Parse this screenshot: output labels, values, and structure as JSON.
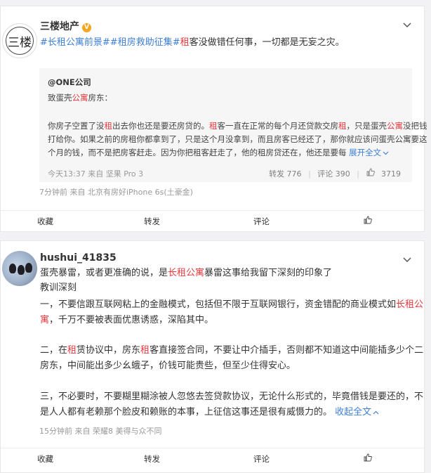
{
  "post1": {
    "author": "三楼地产",
    "verified_badge": "V",
    "avatar_glyph": "三楼",
    "body": {
      "tag1": "#长租公寓前景#",
      "tag2": "#租房救助征集#",
      "k1": "租",
      "rest": "客没做错任何事，一切都是无妄之灾。"
    },
    "quote": {
      "author": "@ONE公司",
      "greeting": {
        "a": "致蛋壳",
        "k": "公寓",
        "b": "房东："
      },
      "p1": {
        "a": "你房子空置了没",
        "k1": "租",
        "b": "出去你也还是要还房贷的。",
        "k2": "租",
        "c": "客一直在正常的每个月还贷款交房",
        "k3": "租",
        "d": "，只是蛋壳",
        "k4": "公寓",
        "e": "没把钱"
      },
      "p2": "打给你。如果之前的房租你都拿到了，只是这个月没拿到，而且房客已经还了，那你就应该问蛋壳公寓要这",
      "p3": "个月的钱，而不是把房客赶走。因为你把租客赶走了，他的租房贷还在，他还是要每",
      "expand": "展开全文",
      "time": "今天13:37",
      "source": "来自 坚果 Pro 3",
      "reposts": "转发 776",
      "comments": "评论 390",
      "likes": "3719"
    },
    "footer_meta": "7分钟前  来自 北京有房好iPhone 6s(土豪金)",
    "actions": {
      "fav": "收藏",
      "repost": "转发",
      "comment": "评论"
    }
  },
  "post2": {
    "author": "hushui_41835",
    "lines": {
      "l1": {
        "a": "蛋壳暴雷，或者更准确的说，是",
        "k": "长租公寓",
        "b": "暴雷这事给我留下深刻的印象了"
      },
      "l2": "教训深刻",
      "l3": {
        "a": "一，不要信跟互联网粘上的金融模式，包括但不限于互联网银行，资金错配的商业模式如",
        "k": "长租公"
      },
      "l4": {
        "k": "寓",
        "b": "，千万不要被表面优惠诱惑，深陷其中。"
      },
      "l5": {
        "a": "二，在",
        "k1": "租",
        "b": "赁协议中，房东",
        "k2": "租",
        "c": "客直接签合同，不要让中介插手，否则都不知道这中间能插多少个二"
      },
      "l6": "房东，中间能出多少幺蛾子，价钱可能贵些，但至少住得安心。",
      "l7": "三，不必要时，不要糊里糊涂被人忽悠去签贷款协议，无论什么形式的，毕竟借钱是要还的，不",
      "l8": "是人人都有老赖那个脸皮和赖账的本事，上征信这事还是很有威慑力的。",
      "expand": "收起全文"
    },
    "footer_meta": "15分钟前  来自 荣耀8 美得与众不同",
    "actions": {
      "fav": "收藏",
      "repost": "转发",
      "comment": "评论"
    }
  },
  "icons": {
    "chevron": "chevron-down-icon",
    "like": "thumbs-up-icon"
  },
  "colors": {
    "link": "#3e7fd6",
    "keyword": "#e8383d",
    "badge": "#f5a623"
  }
}
